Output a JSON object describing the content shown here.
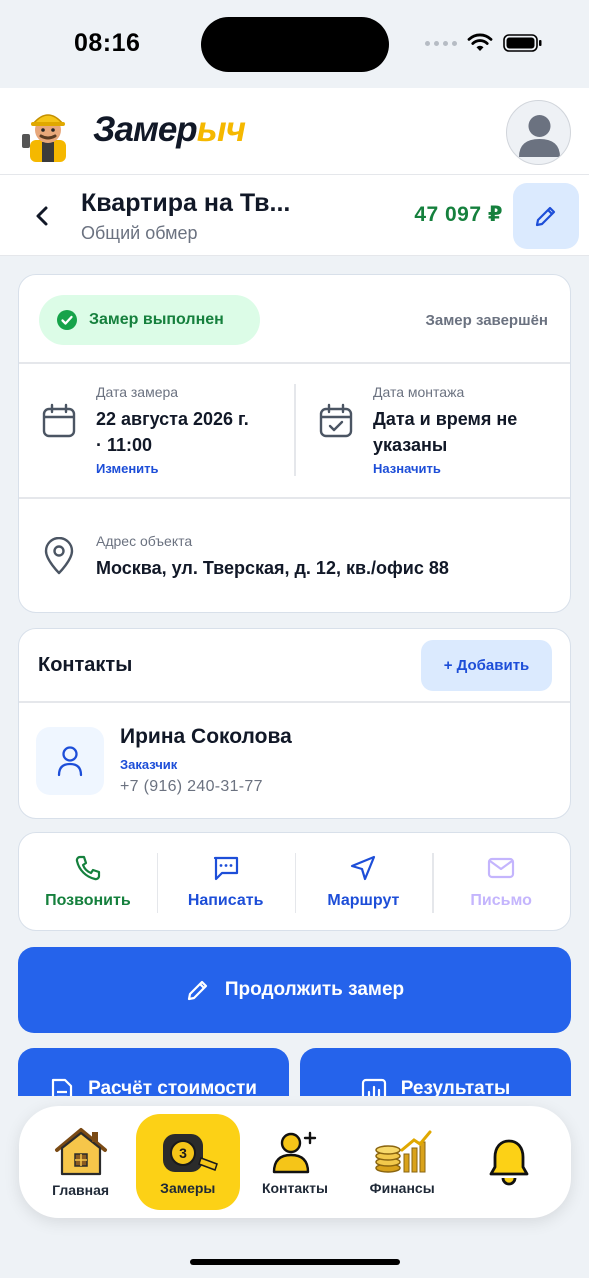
{
  "status_bar": {
    "time": "08:16"
  },
  "header": {
    "brand_part1": "Замер",
    "brand_part2": "ыч"
  },
  "title_bar": {
    "title": "Квартира на Тв...",
    "subtitle": "Общий обмер",
    "price": "47 097 ₽"
  },
  "status_card": {
    "status_badge": "Замер выполнен",
    "status_note": "Замер завершён",
    "measure_date": {
      "label": "Дата замера",
      "value_line1": "22 августа 2026 г.",
      "value_line2": "· 11:00",
      "link": "Изменить"
    },
    "install_date": {
      "label": "Дата монтажа",
      "value_line1": "Дата и время не",
      "value_line2": "указаны",
      "link": "Назначить"
    },
    "address": {
      "label": "Адрес объекта",
      "value": "Москва, ул. Тверская, д. 12, кв./офис 88"
    }
  },
  "contacts": {
    "title": "Контакты",
    "add_label": "+ Добавить",
    "items": [
      {
        "name": "Ирина Соколова",
        "role": "Заказчик",
        "phone": "+7 (916) 240-31-77"
      }
    ]
  },
  "actions": [
    {
      "label": "Позвонить",
      "icon": "phone-icon",
      "color": "#15803d"
    },
    {
      "label": "Написать",
      "icon": "message-icon",
      "color": "#1d4ed8"
    },
    {
      "label": "Маршрут",
      "icon": "navigation-icon",
      "color": "#1d4ed8"
    },
    {
      "label": "Письмо",
      "icon": "mail-icon",
      "color": "#c4b5fd"
    }
  ],
  "buttons": {
    "continue": "Продолжить замер",
    "calc": "Расчёт стоимости",
    "results": "Результаты"
  },
  "bottom_nav": [
    {
      "label": "Главная",
      "icon": "house-icon",
      "active": false
    },
    {
      "label": "Замеры",
      "icon": "tape-measure-icon",
      "active": true
    },
    {
      "label": "Контакты",
      "icon": "add-person-icon",
      "active": false
    },
    {
      "label": "Финансы",
      "icon": "coins-icon",
      "active": false
    },
    {
      "label": "",
      "icon": "bell-icon",
      "active": false
    }
  ],
  "colors": {
    "primary": "#2563eb",
    "success": "#15803d",
    "accent": "#fcd116"
  }
}
